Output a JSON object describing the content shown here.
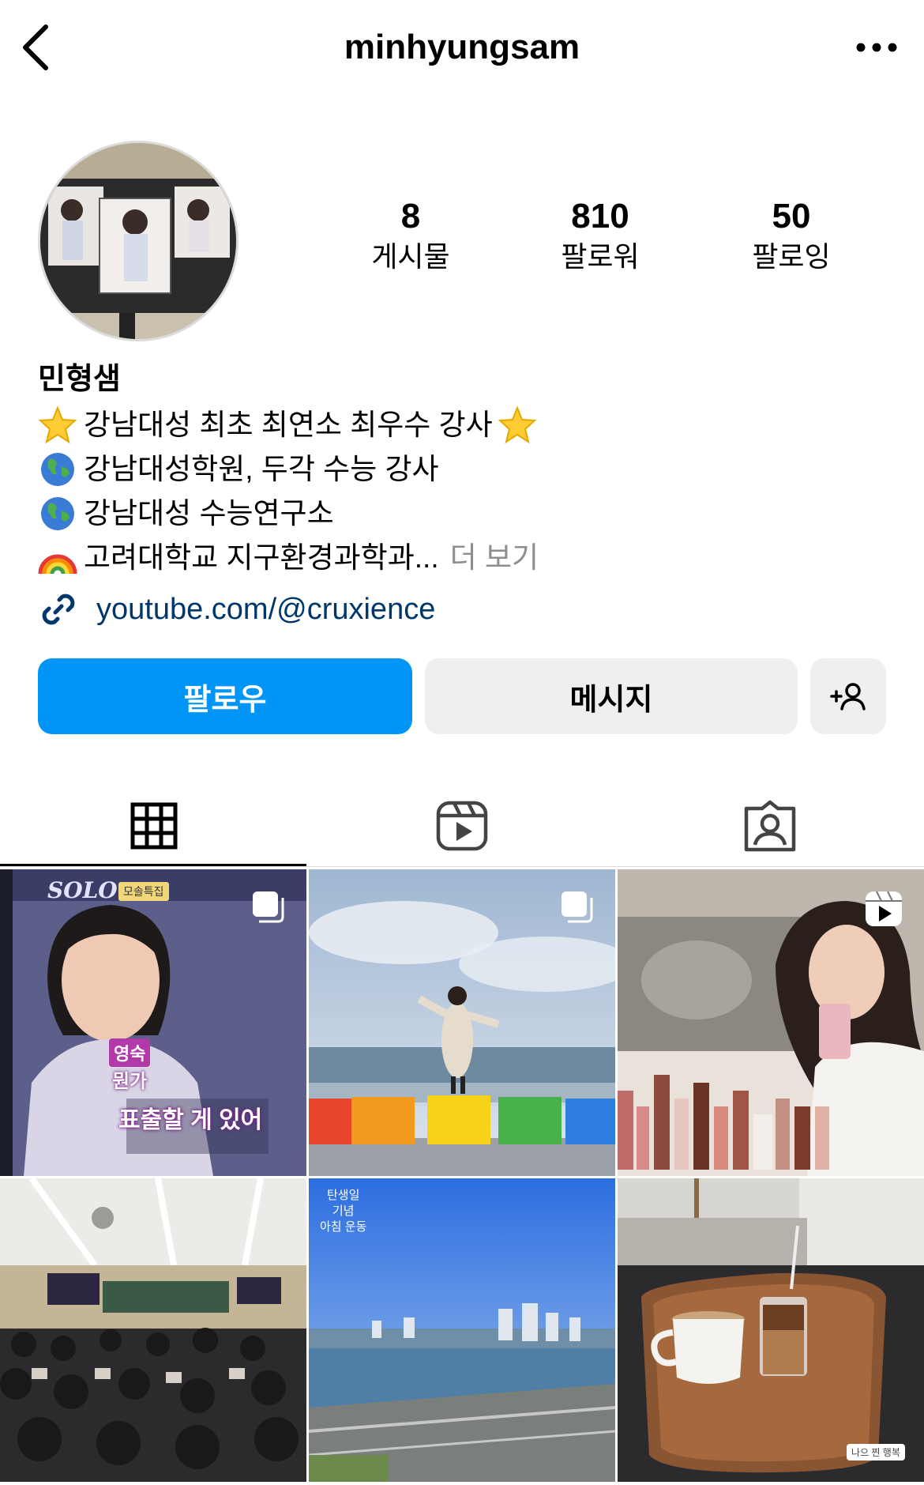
{
  "header": {
    "username": "minhyungsam"
  },
  "stats": [
    {
      "value": "8",
      "label": "게시물"
    },
    {
      "value": "810",
      "label": "팔로워"
    },
    {
      "value": "50",
      "label": "팔로잉"
    }
  ],
  "bio": {
    "name": "민형샘",
    "lines": [
      "강남대성 최초 최연소 최우수 강사",
      "강남대성학원, 두각 수능 강사",
      "강남대성 수능연구소",
      "고려대학교 지구환경과학과..."
    ],
    "more": "더 보기",
    "link": "youtube.com/@cruxience"
  },
  "buttons": {
    "follow": "팔로우",
    "message": "메시지"
  },
  "posts": {
    "p1_show_title": "SOLO",
    "p1_show_tag": "모솔특집",
    "p1_name": "영숙",
    "p1_caption1": "뭔가",
    "p1_caption2": "표출할 게 있어",
    "p5_text1": "탄생일",
    "p5_text2": "기념",
    "p5_text3": "아침 운동",
    "p6_sticker": "나으 찐 행복"
  },
  "colors": {
    "accent": "#0095f6",
    "link": "#00376b",
    "muted": "#8e8e8e"
  }
}
